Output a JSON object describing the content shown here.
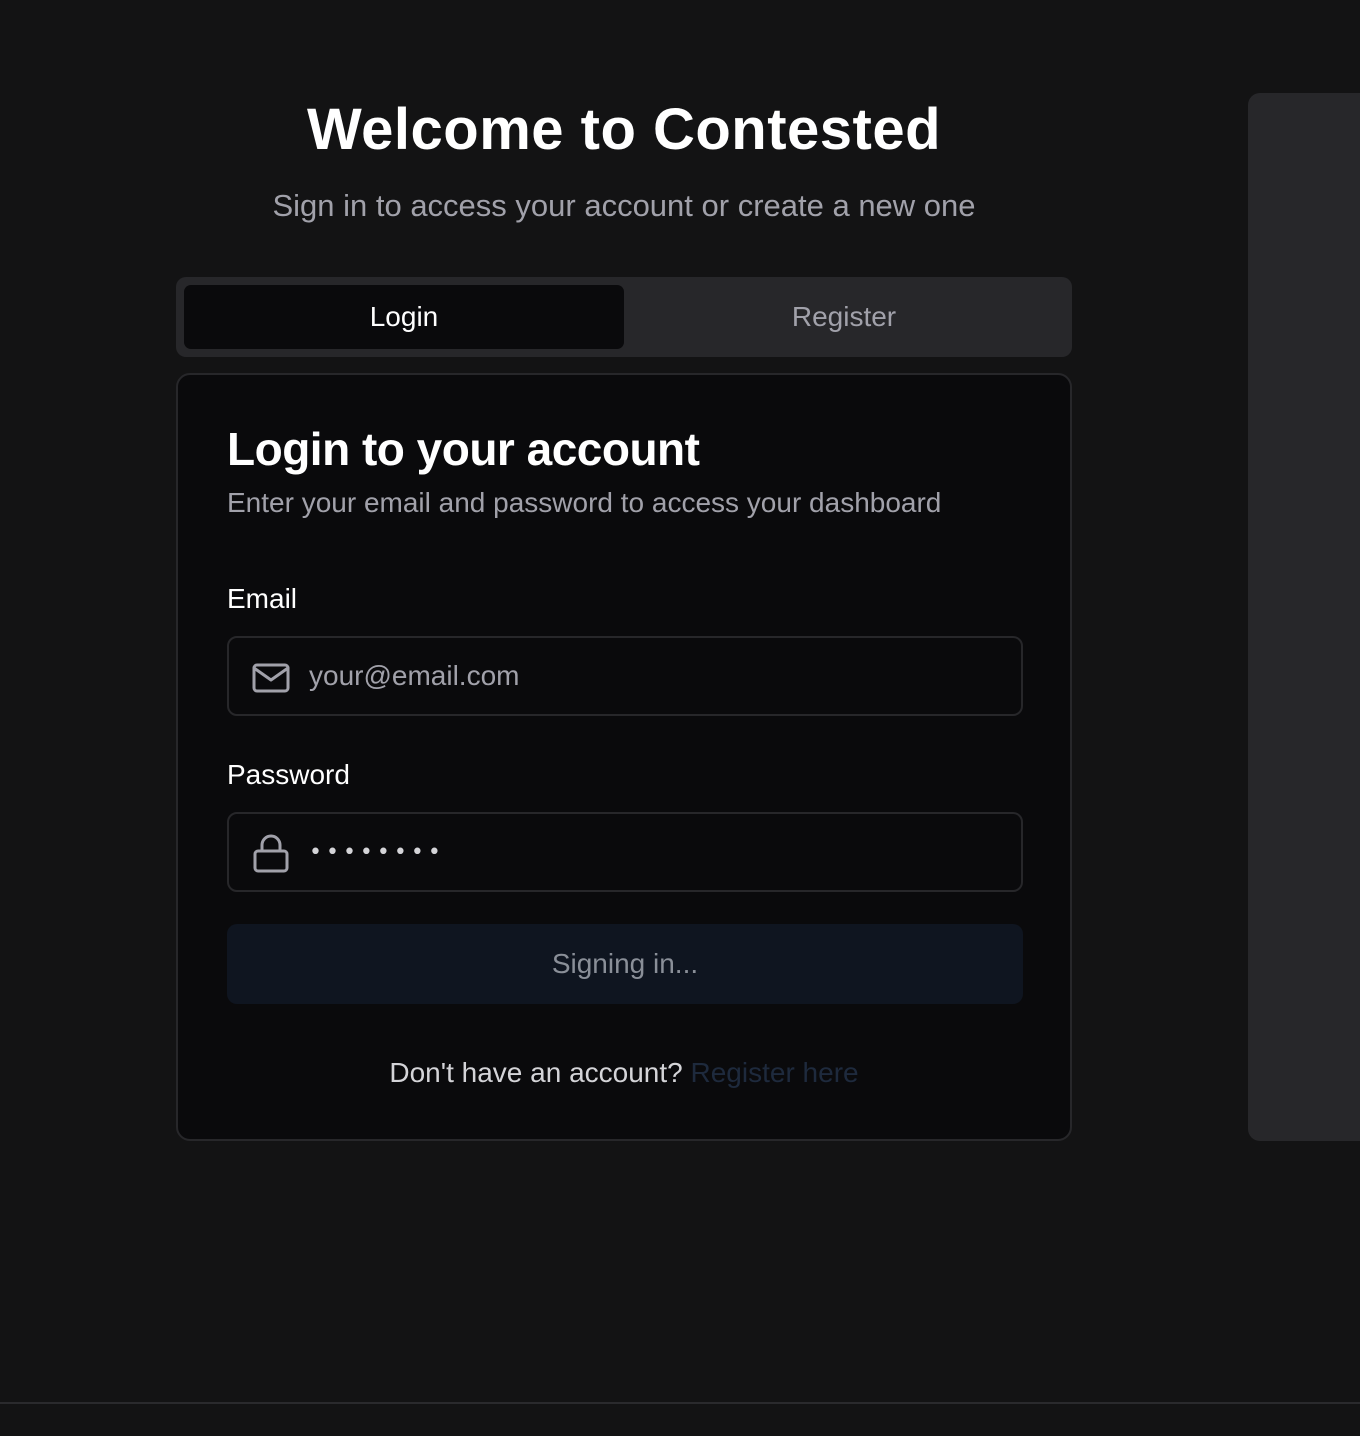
{
  "header": {
    "title": "Welcome to Contested",
    "subtitle": "Sign in to access your account or create a new one"
  },
  "tabs": [
    {
      "label": "Login",
      "active": true
    },
    {
      "label": "Register",
      "active": false
    }
  ],
  "card": {
    "title": "Login to your account",
    "description": "Enter your email and password to access your dashboard",
    "email": {
      "label": "Email",
      "placeholder": "your@email.com",
      "value": "",
      "icon": "mail-icon"
    },
    "password": {
      "label": "Password",
      "value": "password",
      "icon": "lock-icon"
    },
    "submit_label": "Signing in...",
    "footer_prompt": "Don't have an account?",
    "footer_link": "Register here"
  },
  "colors": {
    "background": "#131314",
    "card": "#0a0a0c",
    "border": "#27272a",
    "muted_text": "#a1a1aa",
    "button_bg": "#0f1520",
    "link": "#1e2a3d"
  }
}
